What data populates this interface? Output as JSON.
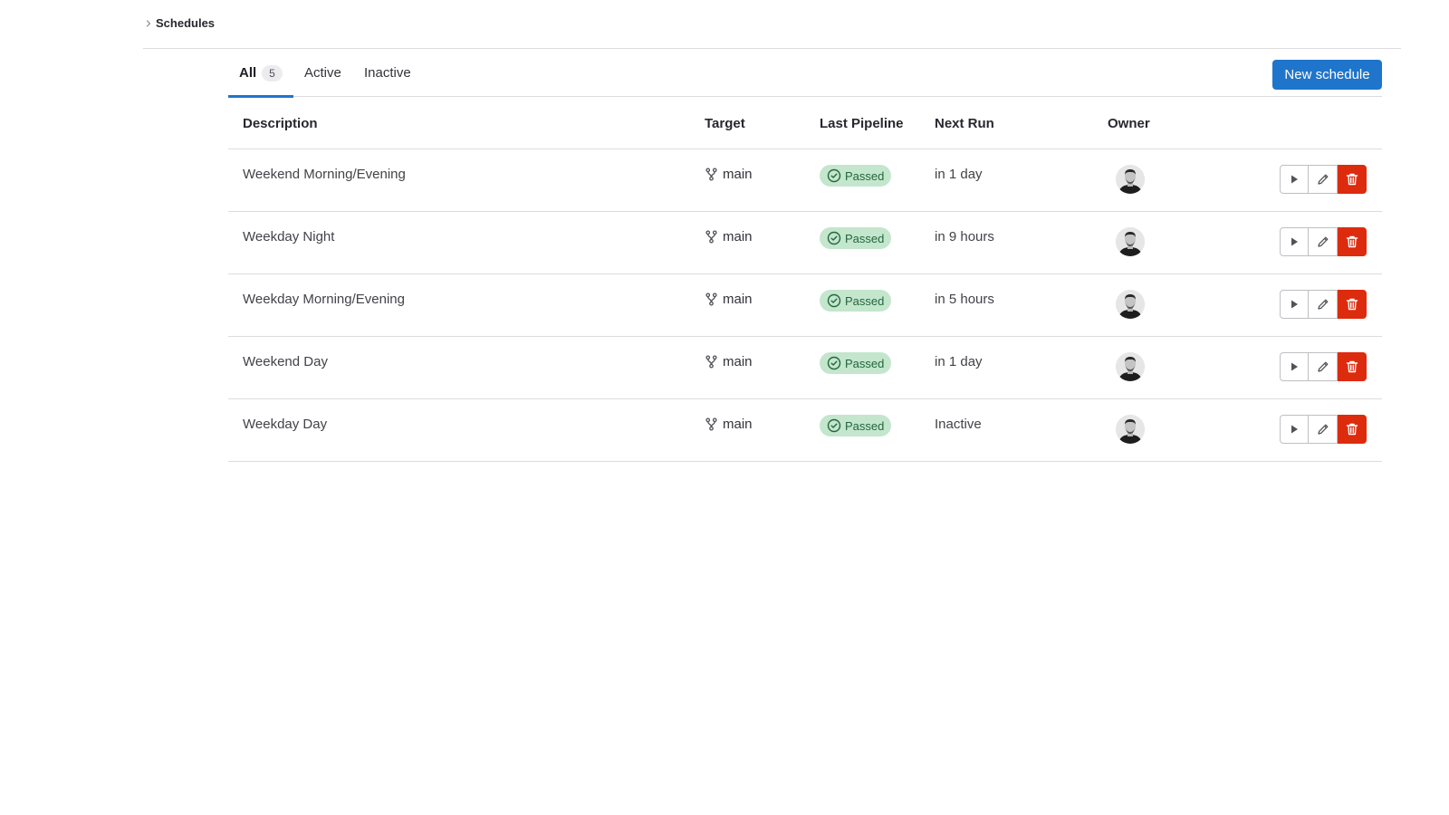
{
  "breadcrumb": {
    "current": "Schedules"
  },
  "tabs": [
    {
      "label": "All",
      "count": "5",
      "selected": true
    },
    {
      "label": "Active",
      "selected": false
    },
    {
      "label": "Inactive",
      "selected": false
    }
  ],
  "toolbar": {
    "new_schedule_label": "New schedule"
  },
  "table": {
    "headers": {
      "description": "Description",
      "target": "Target",
      "last_pipeline": "Last Pipeline",
      "next_run": "Next Run",
      "owner": "Owner"
    },
    "rows": [
      {
        "description": "Weekend Morning/Evening",
        "target": "main",
        "status": "Passed",
        "next_run": "in 1 day"
      },
      {
        "description": "Weekday Night",
        "target": "main",
        "status": "Passed",
        "next_run": "in 9 hours"
      },
      {
        "description": "Weekday Morning/Evening",
        "target": "main",
        "status": "Passed",
        "next_run": "in 5 hours"
      },
      {
        "description": "Weekend Day",
        "target": "main",
        "status": "Passed",
        "next_run": "in 1 day"
      },
      {
        "description": "Weekday Day",
        "target": "main",
        "status": "Passed",
        "next_run": "Inactive"
      }
    ]
  },
  "colors": {
    "accent": "#1f75cb",
    "success_bg": "#c3e6cd",
    "success_text": "#24663b",
    "danger": "#dd2b0e"
  },
  "icons": {
    "breadcrumb": "chevron-right-icon",
    "branch": "branch-icon",
    "status": "check-circle-icon",
    "play": "play-icon",
    "edit": "pencil-icon",
    "delete": "trash-icon"
  }
}
